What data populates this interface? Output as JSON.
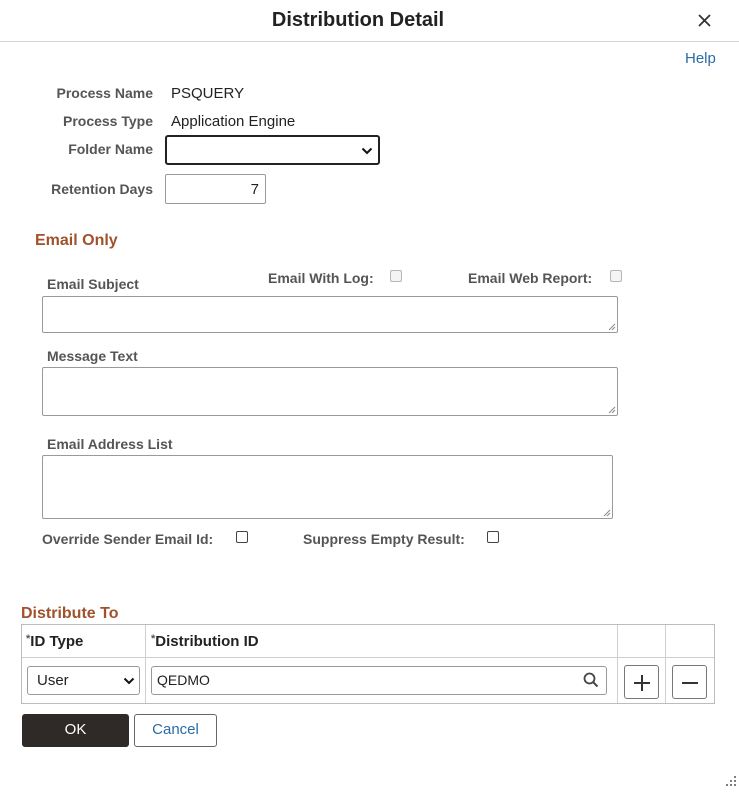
{
  "dialog": {
    "title": "Distribution Detail",
    "help_label": "Help"
  },
  "process": {
    "name_label": "Process Name",
    "name_value": "PSQUERY",
    "type_label": "Process Type",
    "type_value": "Application Engine",
    "folder_label": "Folder Name",
    "folder_value": "",
    "retention_label": "Retention Days",
    "retention_value": "7"
  },
  "email": {
    "section_title": "Email Only",
    "subject_label": "Email Subject",
    "with_log_label": "Email With Log:",
    "with_log_checked": false,
    "web_report_label": "Email Web Report:",
    "web_report_checked": false,
    "message_label": "Message Text",
    "address_label": "Email Address List",
    "override_label": "Override Sender Email Id:",
    "override_checked": false,
    "suppress_label": "Suppress Empty Result:",
    "suppress_checked": false
  },
  "distribute": {
    "section_title": "Distribute To",
    "required_mark": "*",
    "col_id_type": "ID Type",
    "col_dist_id": "Distribution ID",
    "rows": [
      {
        "id_type": "User",
        "distribution_id": "QEDMO"
      }
    ]
  },
  "buttons": {
    "ok": "OK",
    "cancel": "Cancel"
  }
}
